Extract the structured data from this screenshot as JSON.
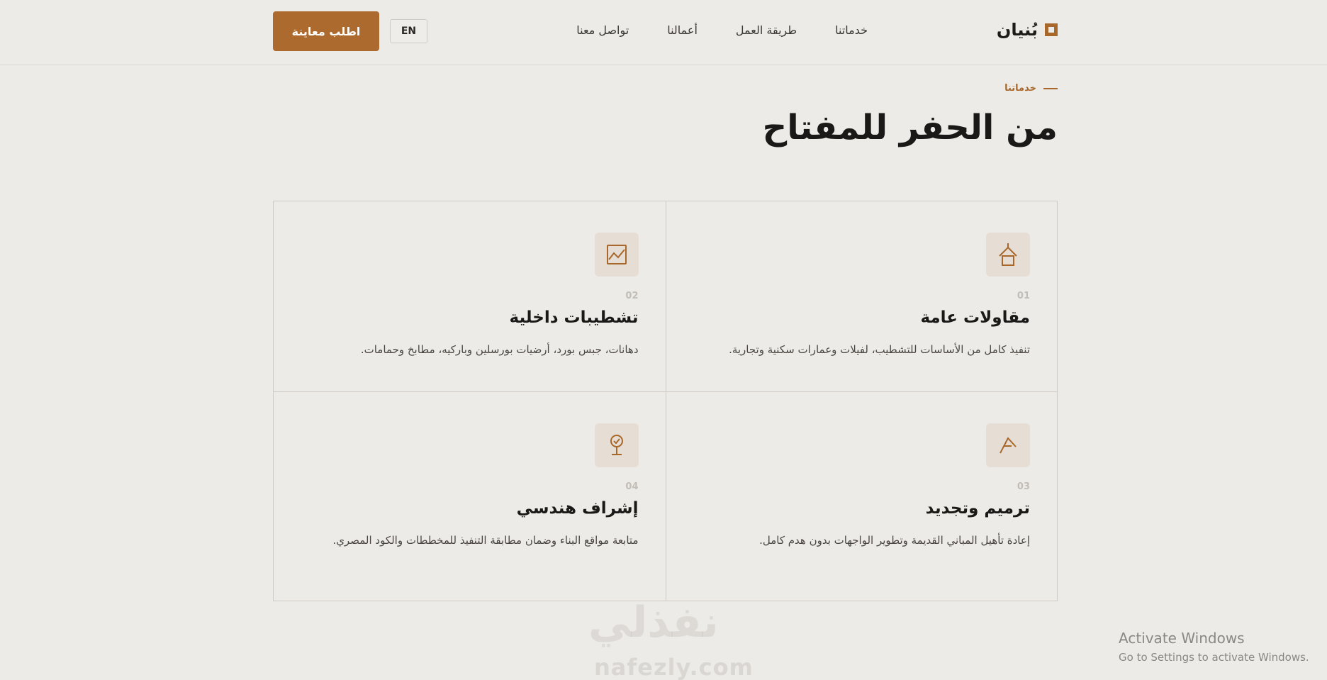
{
  "header": {
    "logo_text": "بُنيان",
    "nav": [
      "خدماتنا",
      "طريقة العمل",
      "أعمالنا",
      "تواصل معنا"
    ],
    "lang_label": "EN",
    "cta_label": "اطلب معاينة"
  },
  "section": {
    "eyebrow": "خدماتنا",
    "title": "من الحفر للمفتاح"
  },
  "services": [
    {
      "num": "01",
      "title": "مقاولات عامة",
      "desc": "تنفيذ كامل من الأساسات للتشطيب، لفيلات وعمارات سكنية وتجارية.",
      "icon": "house-icon"
    },
    {
      "num": "02",
      "title": "تشطيبات داخلية",
      "desc": "دهانات، جبس بورد، أرضيات بورسلين وباركيه، مطابخ وحمامات.",
      "icon": "picture-icon"
    },
    {
      "num": "03",
      "title": "ترميم وتجديد",
      "desc": "إعادة تأهيل المباني القديمة وتطوير الواجهات بدون هدم كامل.",
      "icon": "compass-icon"
    },
    {
      "num": "04",
      "title": "إشراف هندسي",
      "desc": "متابعة مواقع البناء وضمان مطابقة التنفيذ للمخططات والكود المصري.",
      "icon": "badge-icon"
    }
  ],
  "watermark": {
    "text": "نفذلي",
    "sub": "nafezly.com"
  },
  "os_notice": {
    "line1": "Activate Windows",
    "line2": "Go to Settings to activate Windows."
  },
  "colors": {
    "accent": "#ad6a2f",
    "background": "#edebe7",
    "icon_bg": "#e6ded4"
  }
}
